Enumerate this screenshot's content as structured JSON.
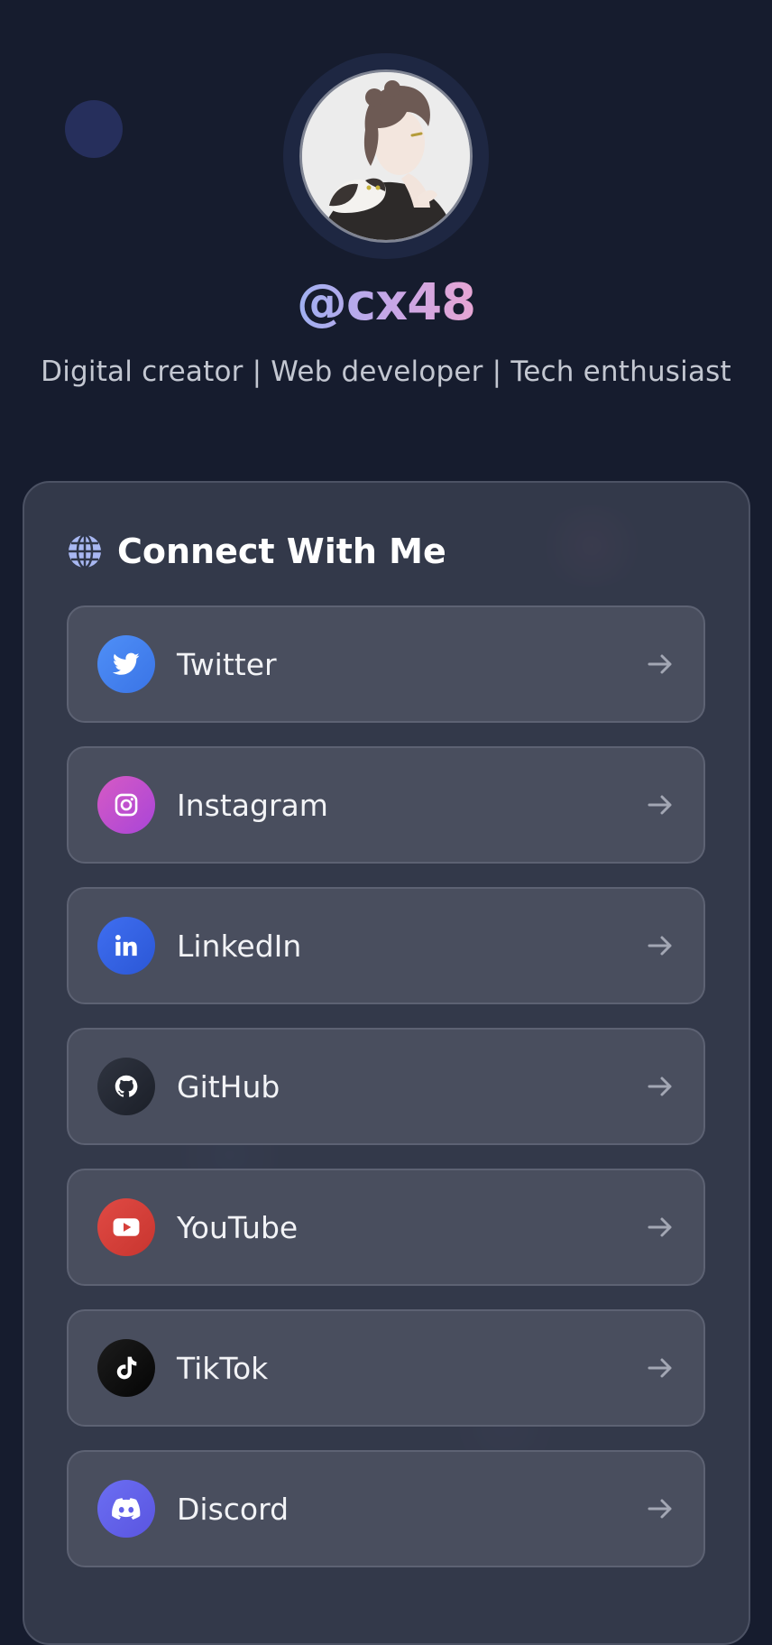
{
  "profile": {
    "handle": "@cx48",
    "bio": "Digital creator | Web developer | Tech enthusiast",
    "avatar_alt": "profile avatar"
  },
  "card": {
    "title": "Connect With Me",
    "icon": "globe-icon"
  },
  "links": [
    {
      "label": "Twitter",
      "icon": "twitter-icon",
      "color": "#4a86f3"
    },
    {
      "label": "Instagram",
      "icon": "instagram-icon",
      "color": "#c24fcf"
    },
    {
      "label": "LinkedIn",
      "icon": "linkedin-icon",
      "color": "#3763e6"
    },
    {
      "label": "GitHub",
      "icon": "github-icon",
      "color": "#262a34"
    },
    {
      "label": "YouTube",
      "icon": "youtube-icon",
      "color": "#d6403a"
    },
    {
      "label": "TikTok",
      "icon": "tiktok-icon",
      "color": "#111111"
    },
    {
      "label": "Discord",
      "icon": "discord-icon",
      "color": "#6264ea"
    }
  ],
  "theme": {
    "background": "#161c2e",
    "card": "#383e4e",
    "link_item": "#494e5e",
    "accent_gradient": [
      "#9fb0f2",
      "#e7a6d4"
    ]
  }
}
